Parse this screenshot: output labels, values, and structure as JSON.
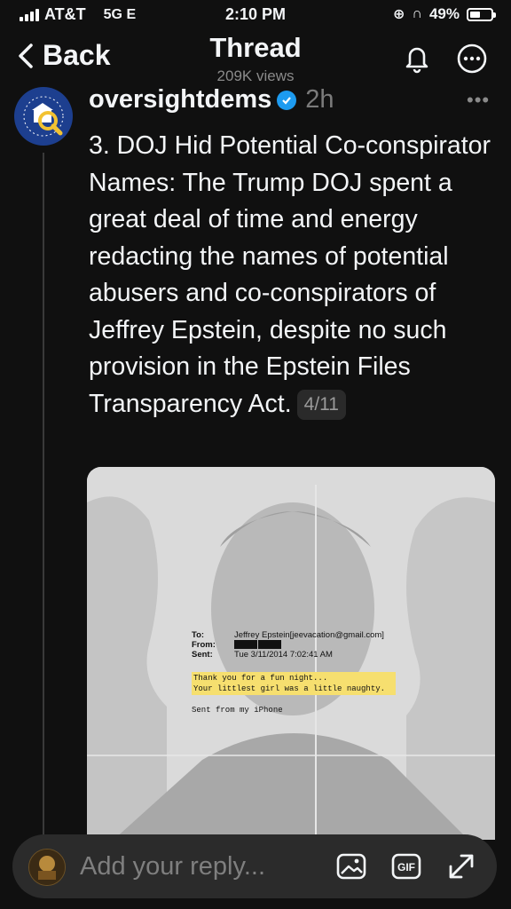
{
  "status_bar": {
    "carrier": "AT&T",
    "network": "5G E",
    "time": "2:10 PM",
    "battery": "49%",
    "battery_level": 0.49
  },
  "header": {
    "back_label": "Back",
    "title": "Thread",
    "views": "209K views"
  },
  "post": {
    "author": "oversightdems",
    "time_ago": "2h",
    "text": "3. DOJ Hid Potential Co-conspirator Names: The Trump DOJ spent a great deal of time and energy redacting the names of potential abusers and co-conspirators of Jeffrey Epstein, despite no such provision in the Epstein Files Transparency Act.",
    "counter": "4/11",
    "image": {
      "to_label": "To:",
      "from_label": "From:",
      "sent_label": "Sent:",
      "to_value": "Jeffrey Epstein[jeevacation@gmail.com]",
      "sent_value": "Tue 3/11/2014 7:02:41 AM",
      "highlight_line1": "Thank you for a fun night...",
      "highlight_line2": "Your littlest girl was a little naughty.",
      "signature": "Sent from my iPhone",
      "highlight_color": "#f6df6f"
    }
  },
  "reply_bar": {
    "placeholder": "Add your reply..."
  },
  "icons": [
    "chevron-left-icon",
    "bell-icon",
    "more-icon",
    "verified-icon",
    "image-icon",
    "gif-icon",
    "expand-icon"
  ],
  "colors": {
    "background": "#101010",
    "verified": "#1d9bf0",
    "avatar_bg": "#1d3f8f"
  }
}
